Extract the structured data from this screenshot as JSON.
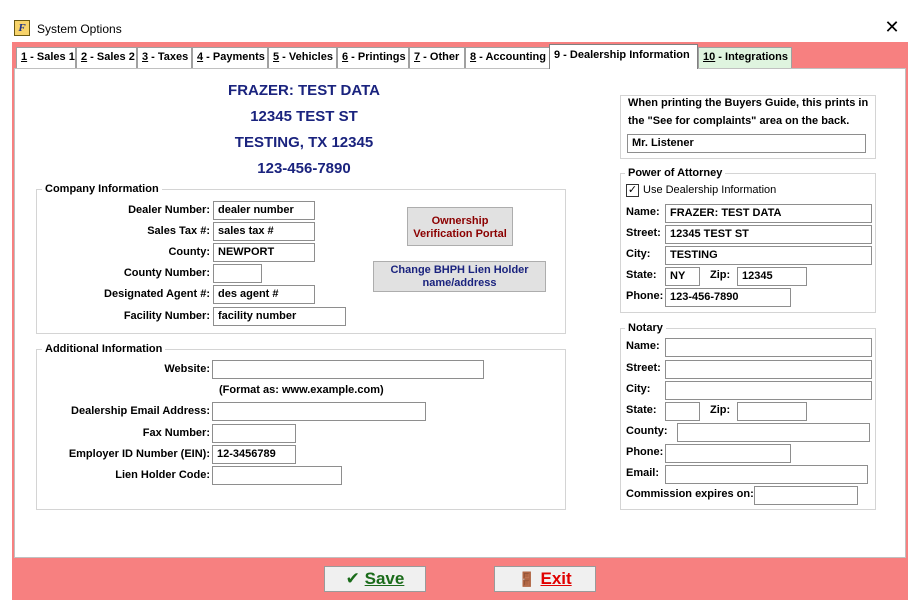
{
  "window": {
    "title": "System Options",
    "close_glyph": "✕",
    "icon_letter": "F"
  },
  "tabs": [
    {
      "key": "1",
      "label": " - Sales 1"
    },
    {
      "key": "2",
      "label": " - Sales 2"
    },
    {
      "key": "3",
      "label": " - Taxes"
    },
    {
      "key": "4",
      "label": " - Payments"
    },
    {
      "key": "5",
      "label": " - Vehicles"
    },
    {
      "key": "6",
      "label": " - Printings"
    },
    {
      "key": "7",
      "label": " - Other"
    },
    {
      "key": "8",
      "label": " - Accounting"
    },
    {
      "key": "9",
      "label": " - Dealership Information"
    },
    {
      "key": "10",
      "label": " - Integrations"
    }
  ],
  "dealer_header": {
    "name": "FRAZER: TEST DATA",
    "street": "12345 TEST ST",
    "city_line": "TESTING, TX 12345",
    "phone": "123-456-7890"
  },
  "company_info": {
    "title": "Company Information",
    "dealer_number_label": "Dealer Number:",
    "dealer_number": "dealer number",
    "sales_tax_label": "Sales Tax #:",
    "sales_tax": "sales tax #",
    "county_label": "County:",
    "county": "NEWPORT",
    "county_number_label": "County Number:",
    "county_number": "",
    "designated_agent_label": "Designated Agent #:",
    "designated_agent": "des agent #",
    "facility_number_label": "Facility Number:",
    "facility_number": "facility number",
    "ownership_button": "Ownership Verification Portal",
    "lien_holder_button": "Change BHPH Lien Holder name/address"
  },
  "additional_info": {
    "title": "Additional Information",
    "website_label": "Website:",
    "website": "",
    "website_hint": "(Format as: www.example.com)",
    "email_label": "Dealership Email Address:",
    "email": "",
    "fax_label": "Fax Number:",
    "fax": "",
    "ein_label": "Employer ID Number (EIN):",
    "ein": "12-3456789",
    "lien_code_label": "Lien Holder Code:",
    "lien_code": ""
  },
  "buyers_guide": {
    "text_line1": "When printing the Buyers Guide, this prints in",
    "text_line2": "the \"See for complaints\" area on the back.",
    "value": "Mr. Listener"
  },
  "power_of_attorney": {
    "title": "Power of Attorney",
    "use_dealership_label": "Use Dealership Information",
    "use_dealership_checked": "✓",
    "name_label": "Name:",
    "name": "FRAZER: TEST DATA",
    "street_label": "Street:",
    "street": "12345 TEST ST",
    "city_label": "City:",
    "city": "TESTING",
    "state_label": "State:",
    "state": "NY",
    "zip_label": "Zip:",
    "zip": "12345",
    "phone_label": "Phone:",
    "phone": "123-456-7890"
  },
  "notary": {
    "title": "Notary",
    "name_label": "Name:",
    "name": "",
    "street_label": "Street:",
    "street": "",
    "city_label": "City:",
    "city": "",
    "state_label": "State:",
    "state": "",
    "zip_label": "Zip:",
    "zip": "",
    "county_label": "County:",
    "county": "",
    "phone_label": "Phone:",
    "phone": "",
    "email_label": "Email:",
    "email": "",
    "commission_label": "Commission expires on:",
    "commission": ""
  },
  "footer": {
    "save_label": "Save",
    "save_icon": "✔",
    "exit_label": "Exit",
    "exit_icon": "🚪"
  },
  "colors": {
    "frame": "#f78080",
    "header_text": "#1a237e",
    "ownership_text": "#8b0000",
    "lien_text": "#1a237e",
    "save_green": "#1a6b1a",
    "exit_red": "#e00000"
  }
}
